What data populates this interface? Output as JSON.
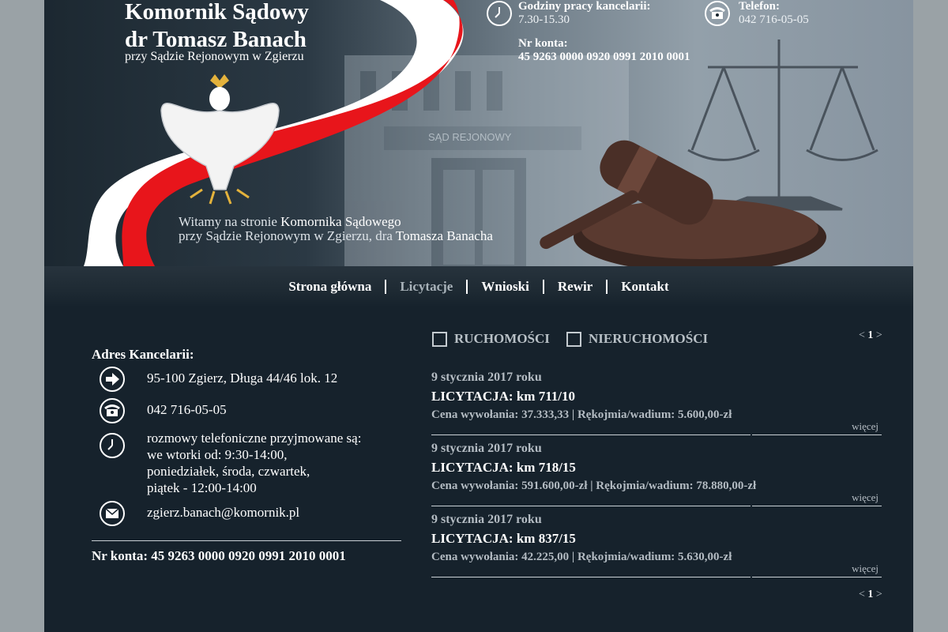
{
  "header": {
    "title_line1": "Komornik Sądowy",
    "title_line2": "dr Tomasz Banach",
    "subtitle": "przy Sądzie Rejonowym w Zgierzu",
    "welcome_part1": "Witamy na stronie ",
    "welcome_hl1": "Komornika Sądowego",
    "welcome_part2": "przy Sądzie Rejonowym w Zgierzu, dra ",
    "welcome_hl2": "Tomasza Banacha",
    "hours_label": "Godziny pracy kancelarii:",
    "hours_value": "7.30-15.30",
    "phone_label": "Telefon:",
    "phone_value": "042 716-05-05",
    "account_label": "Nr konta:",
    "account_value": "45 9263 0000 0920 0991 2010 0001",
    "building_sign": "SĄD REJONOWY"
  },
  "nav": {
    "items": [
      "Strona główna",
      "Licytacje",
      "Wnioski",
      "Rewir",
      "Kontakt"
    ],
    "active": "Licytacje"
  },
  "office": {
    "title": "Adres Kancelarii:",
    "address": "95-100 Zgierz, Długa 44/46 lok. 12",
    "phone": "042 716-05-05",
    "hours_line1": "rozmowy telefoniczne przyjmowane są:",
    "hours_line2": "we wtorki od: 9:30-14:00,",
    "hours_line3": "poniedziałek, środa, czwartek,",
    "hours_line4": "piątek - 12:00-14:00",
    "email": "zgierz.banach@komornik.pl",
    "account": "Nr konta: 45 9263 0000 0920 0991 2010 0001"
  },
  "filters": {
    "movables": "RUCHOMOŚCI",
    "realestate": "NIERUCHOMOŚCI"
  },
  "pager": {
    "prev": "<",
    "current": "1",
    "next": ">"
  },
  "auctions": [
    {
      "date": "9 stycznia 2017 roku",
      "title": "LICYTACJA: km 711/10",
      "price": "Cena wywołania: 37.333,33 | Rękojmia/wadium: 5.600,00-zł",
      "more": "więcej"
    },
    {
      "date": "9 stycznia 2017 roku",
      "title": "LICYTACJA: km 718/15",
      "price": "Cena wywołania: 591.600,00-zł | Rękojmia/wadium: 78.880,00-zł",
      "more": "więcej"
    },
    {
      "date": "9 stycznia 2017 roku",
      "title": "LICYTACJA: km 837/15",
      "price": "Cena wywołania: 42.225,00 | Rękojmia/wadium: 5.630,00-zł",
      "more": "więcej"
    }
  ],
  "colors": {
    "page_bg": "#16222c",
    "outer_bg": "#9aa2a6",
    "flag_red": "#e8151b",
    "flag_white": "#ffffff",
    "muted_text": "#b4bcc3"
  }
}
